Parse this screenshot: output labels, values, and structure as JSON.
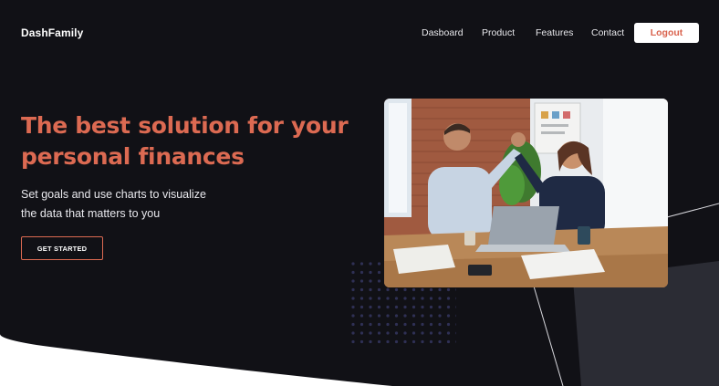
{
  "brand": {
    "name": "DashFamily"
  },
  "nav": {
    "items": [
      {
        "label": "Dasboard"
      },
      {
        "label": "Product"
      },
      {
        "label": "Features"
      },
      {
        "label": "Contact"
      }
    ],
    "logout_label": "Logout"
  },
  "hero": {
    "headline_line1": "The best solution for your",
    "headline_line2": "personal finances",
    "subtext_line1": "Set goals and use charts to visualize",
    "subtext_line2": "the data that matters to you",
    "cta_label": "GET STARTED"
  },
  "colors": {
    "background_dark": "#111116",
    "accent": "#dc6a52",
    "shape_gray": "#2b2c34",
    "text_light": "#ffffff"
  },
  "icons": {
    "hero_image": "office-high-five-photo",
    "decoration": "dot-grid-pattern"
  }
}
